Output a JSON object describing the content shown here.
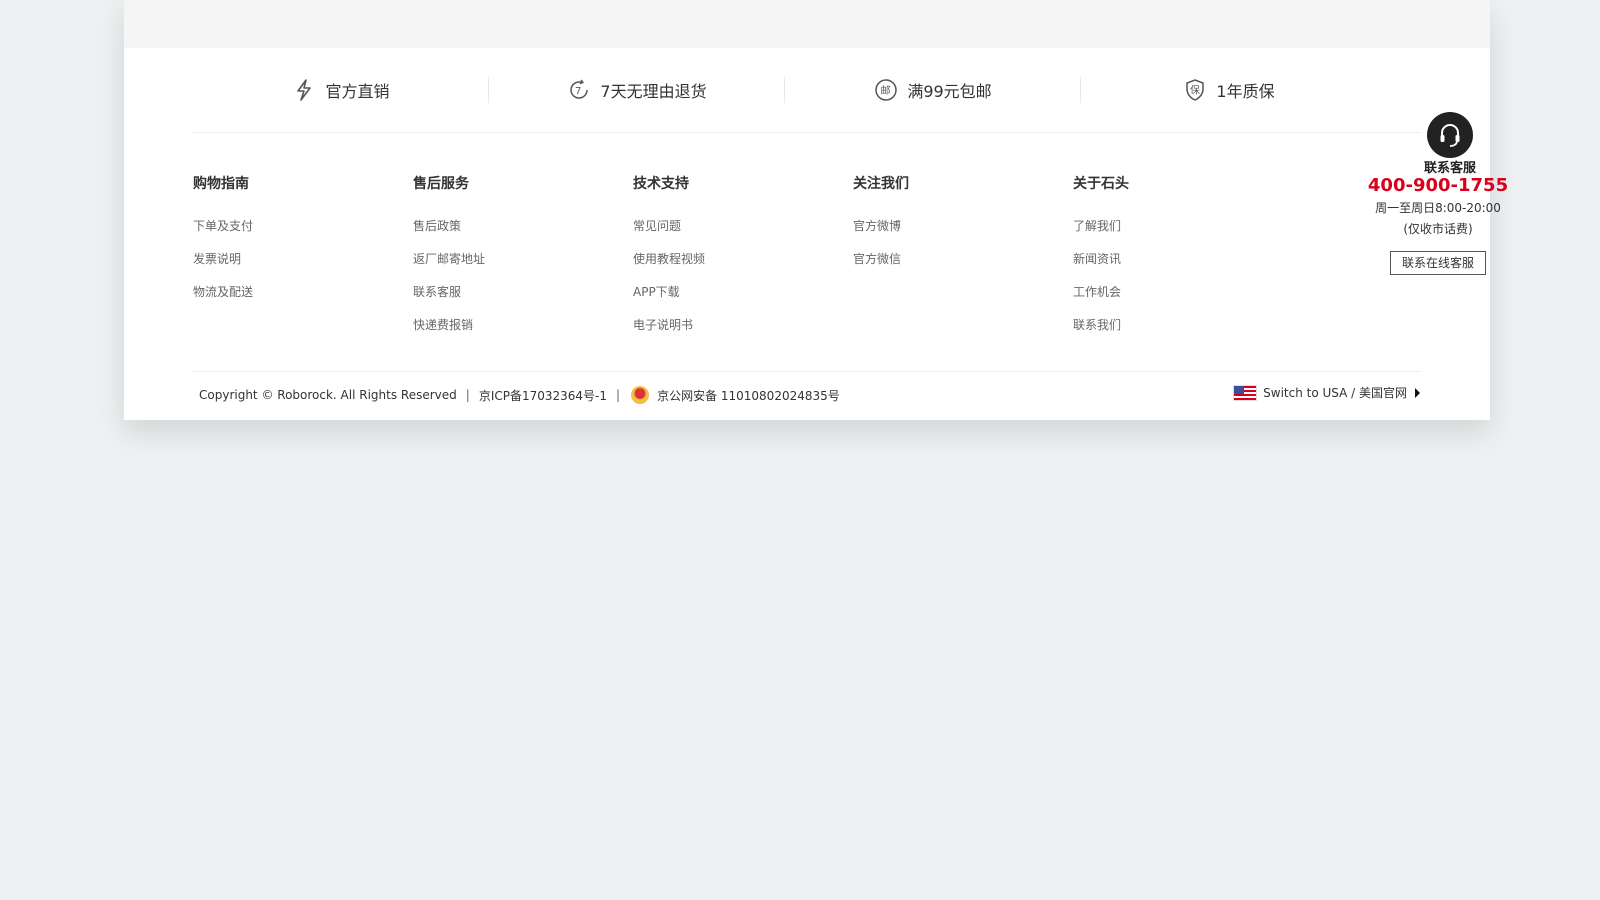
{
  "promises": [
    {
      "icon": "lightning-icon",
      "label": "官方直销"
    },
    {
      "icon": "seven-day-return-icon",
      "label": "7天无理由退货"
    },
    {
      "icon": "mail-stamp-icon",
      "label": "满99元包邮"
    },
    {
      "icon": "shield-guarantee-icon",
      "label": "1年质保"
    }
  ],
  "icons": {
    "return_glyph": "7",
    "mail_glyph": "邮",
    "shield_glyph": "保"
  },
  "footer": {
    "columns": [
      {
        "title": "购物指南",
        "links": [
          "下单及支付",
          "发票说明",
          "物流及配送"
        ]
      },
      {
        "title": "售后服务",
        "links": [
          "售后政策",
          "返厂邮寄地址",
          "联系客服",
          "快递费报销"
        ]
      },
      {
        "title": "技术支持",
        "links": [
          "常见问题",
          "使用教程视频",
          "APP下载",
          "电子说明书"
        ]
      },
      {
        "title": "关注我们",
        "links": [
          "官方微博",
          "官方微信"
        ]
      },
      {
        "title": "关于石头",
        "links": [
          "了解我们",
          "新闻资讯",
          "工作机会",
          "联系我们"
        ]
      }
    ],
    "contact": {
      "phone": "400-900-1755",
      "hours": "周一至周日8:00-20:00",
      "fee": "(仅收市话费)",
      "online_button": "联系在线客服"
    }
  },
  "bottom": {
    "copyright": "Copyright © Roborock. All Rights Reserved",
    "icp": "京ICP备17032364号-1",
    "police": "京公网安备 11010802024835号",
    "switch_region": "Switch to USA / 美国官网"
  },
  "floating_service": {
    "label": "联系客服"
  },
  "colors": {
    "accent": "#d9001b",
    "text": "#333333",
    "muted": "#666666",
    "background": "#edf1f2"
  }
}
